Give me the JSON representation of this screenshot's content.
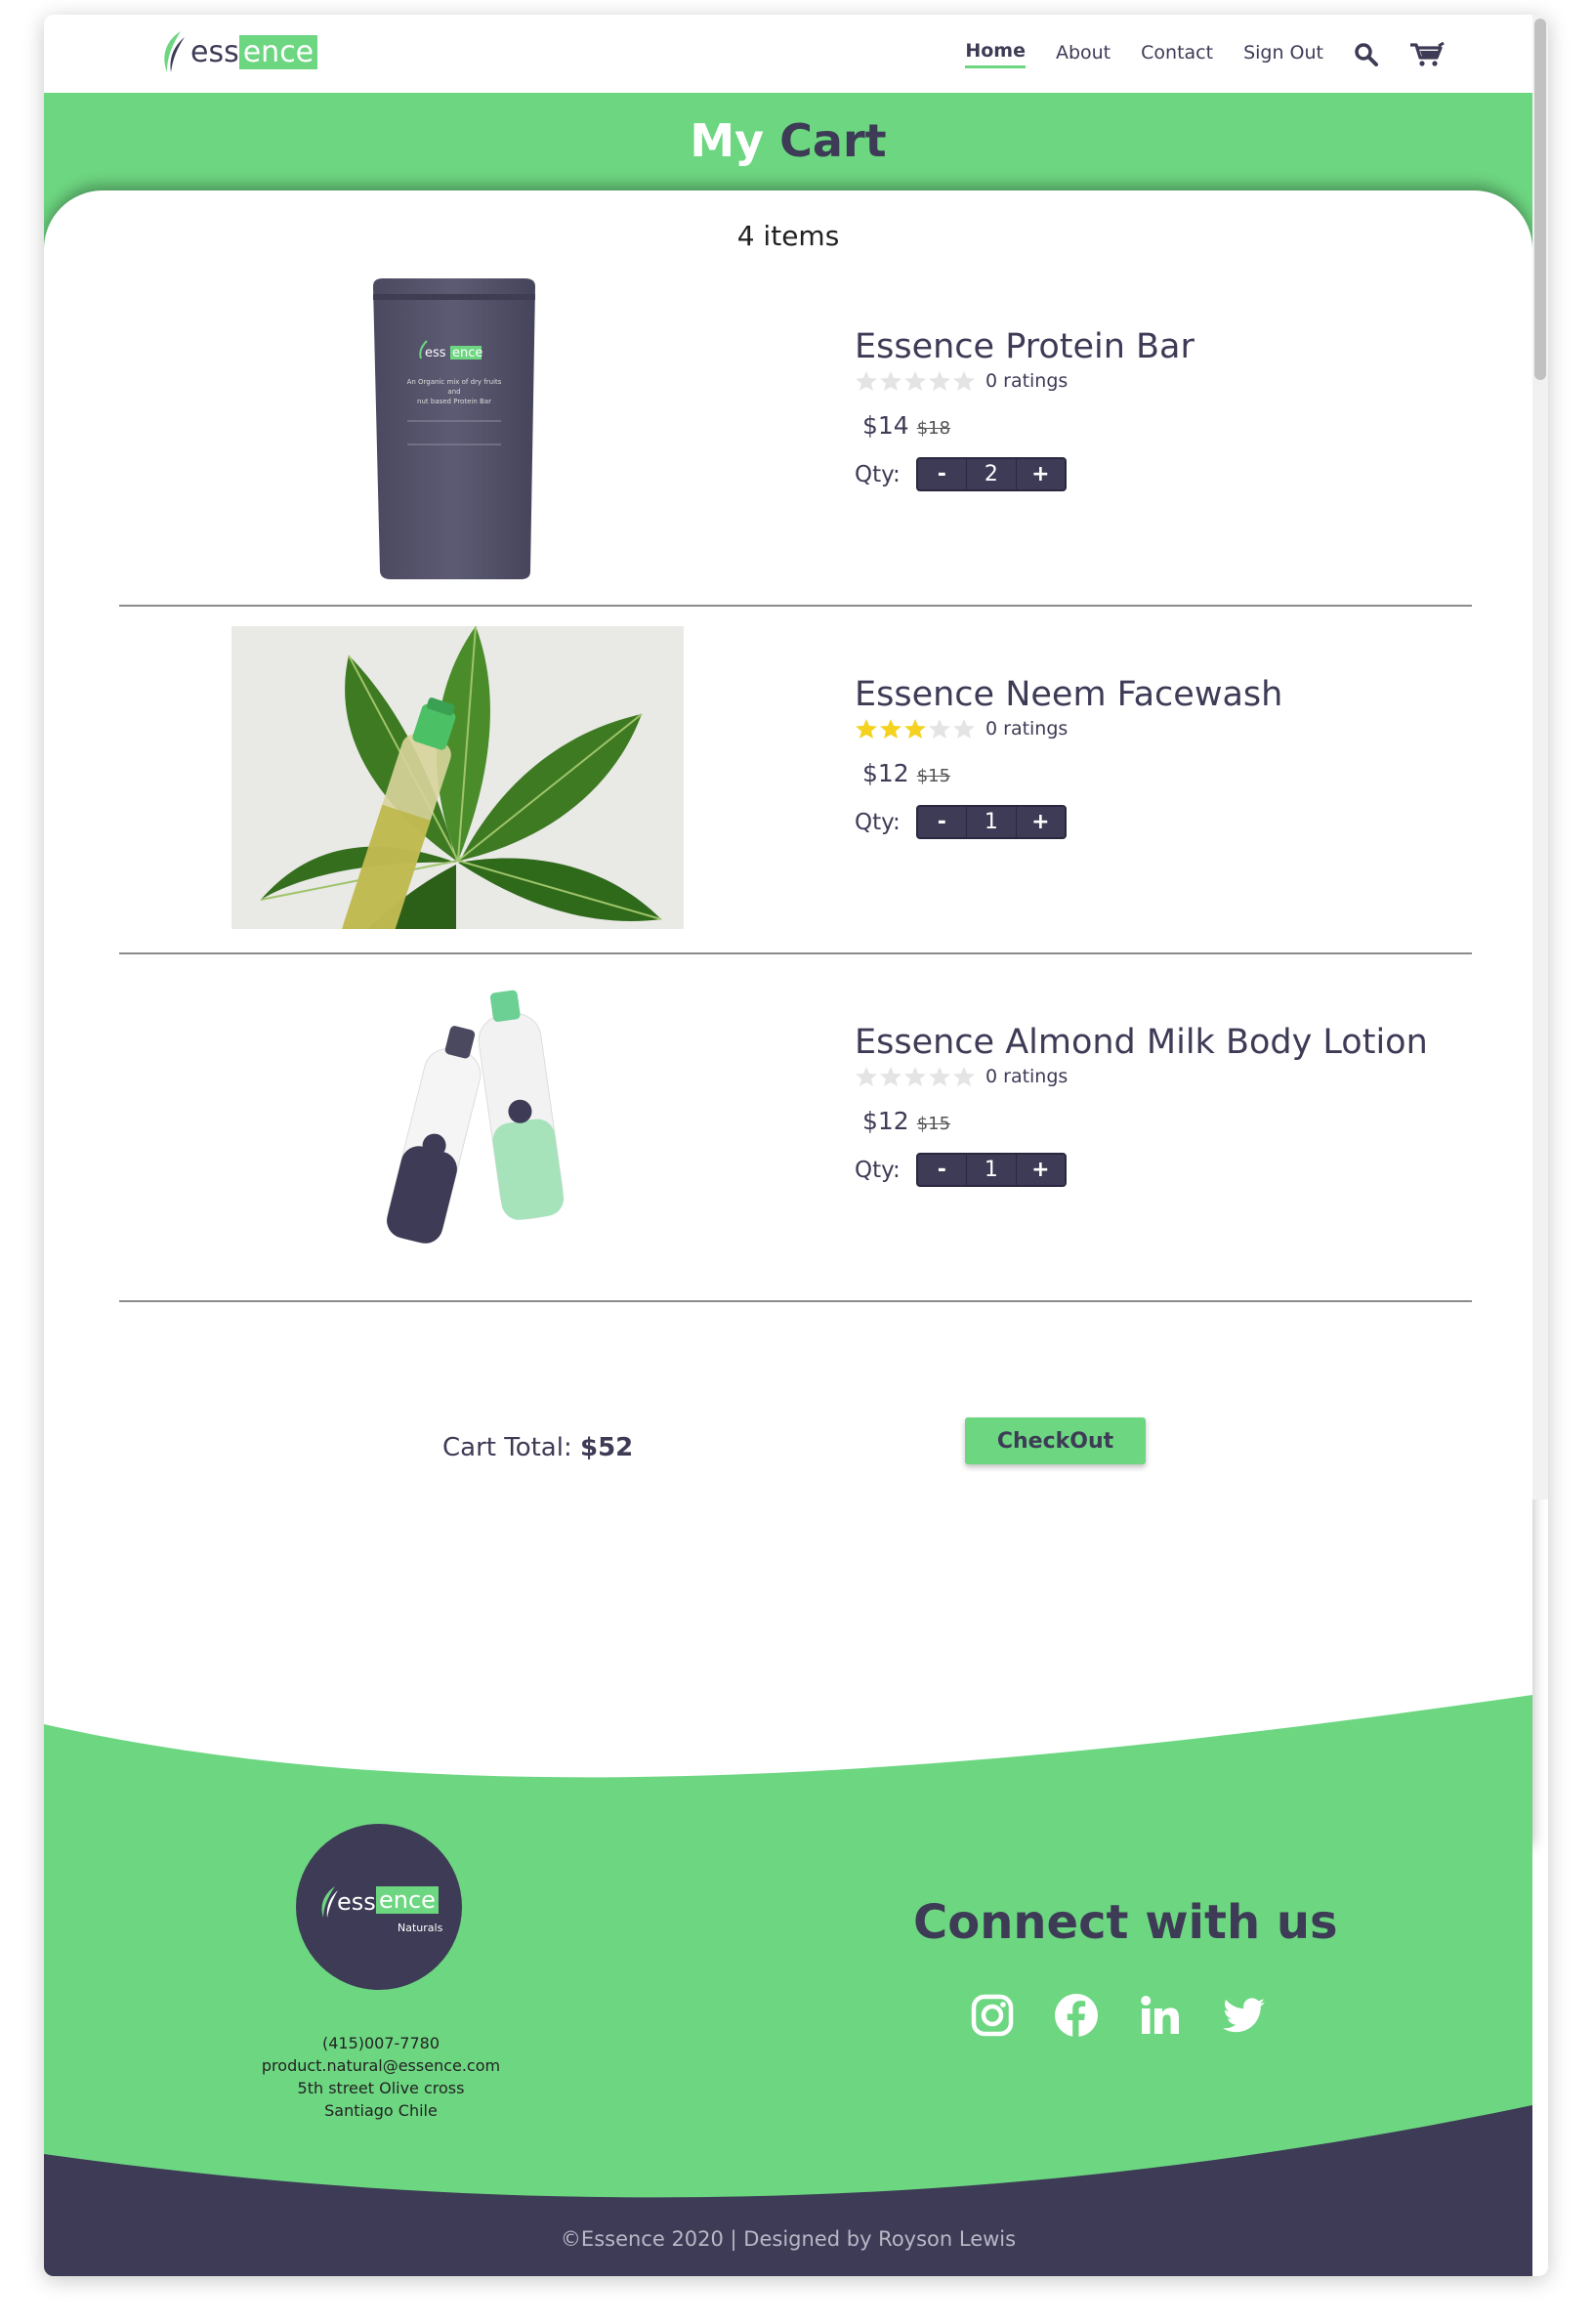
{
  "brand": {
    "logo_ess": "ess",
    "logo_ence": "ence",
    "footer_sub": "Naturals"
  },
  "nav": {
    "items": [
      {
        "label": "Home",
        "active": true
      },
      {
        "label": "About",
        "active": false
      },
      {
        "label": "Contact",
        "active": false
      },
      {
        "label": "Sign Out",
        "active": false
      }
    ],
    "icons": [
      "search-icon",
      "cart-icon"
    ]
  },
  "page": {
    "title_word1": "My",
    "title_word2": "Cart",
    "items_count": "4 items"
  },
  "cart": {
    "items": [
      {
        "name": "Essence Protein Bar",
        "stars": 0,
        "ratings": "0 ratings",
        "price": "$14",
        "old_price": "$18",
        "qty_label": "Qty:",
        "qty": "2",
        "minus": "-",
        "plus": "+"
      },
      {
        "name": "Essence Neem Facewash",
        "stars": 3,
        "ratings": "0 ratings",
        "price": "$12",
        "old_price": "$15",
        "qty_label": "Qty:",
        "qty": "1",
        "minus": "-",
        "plus": "+"
      },
      {
        "name": "Essence Almond Milk Body Lotion",
        "stars": 0,
        "ratings": "0 ratings",
        "price": "$12",
        "old_price": "$15",
        "qty_label": "Qty:",
        "qty": "1",
        "minus": "-",
        "plus": "+"
      }
    ],
    "total_label": "Cart Total:",
    "total_value": "$52",
    "checkout_label": "CheckOut"
  },
  "footer": {
    "phone": "(415)007-7780",
    "email": "product.natural@essence.com",
    "address1": "5th street Olive cross",
    "address2": "Santiago Chile",
    "connect_title": "Connect with us",
    "social": [
      "instagram-icon",
      "facebook-icon",
      "linkedin-icon",
      "twitter-icon"
    ],
    "copyright": "©Essence 2020 | Designed by Royson Lewis"
  },
  "colors": {
    "brand_green": "#6dd681",
    "brand_navy": "#3d3b55",
    "star_gold": "#f4d21f",
    "star_empty": "#e4e4e4"
  }
}
